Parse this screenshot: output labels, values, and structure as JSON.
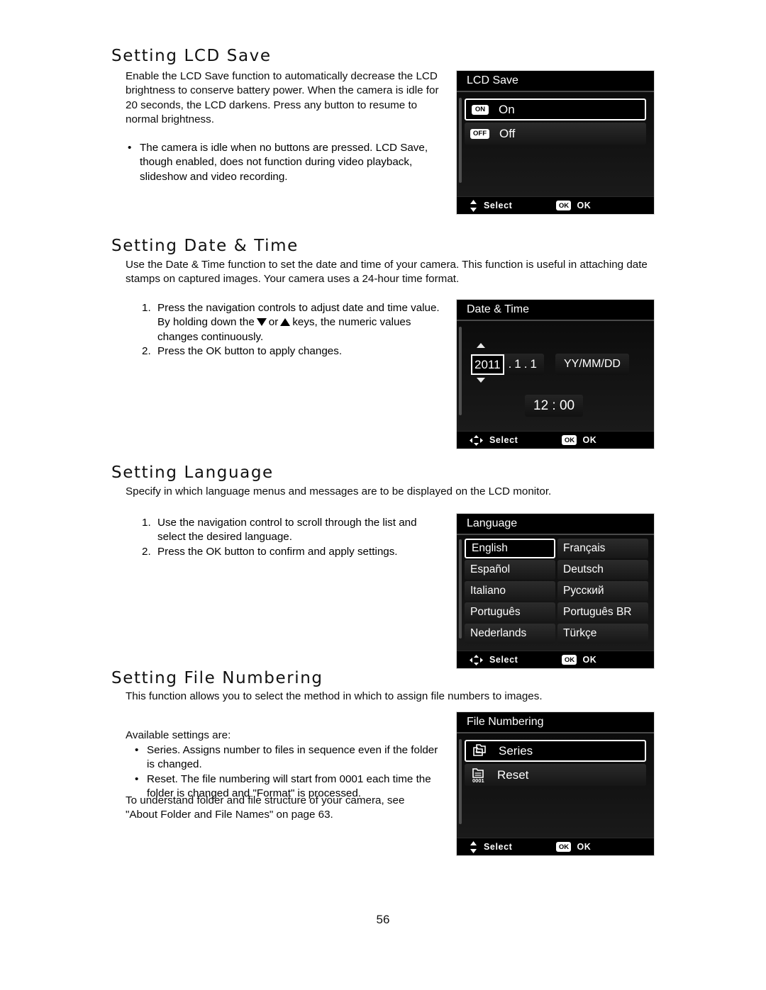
{
  "page": {
    "number": "56"
  },
  "sections": [
    {
      "id": "lcd_save",
      "title": "Setting LCD Save",
      "paragraph": "Enable the LCD Save function to automatically decrease the LCD brightness to conserve battery power. When the camera is idle for 20 seconds, the LCD darkens. Press any button to resume to normal brightness.",
      "bullets": [
        "The camera is idle when no buttons are pressed. LCD Save, though enabled, does not function during video playback, slideshow and video recording."
      ]
    },
    {
      "id": "date_time",
      "title": "Setting Date & Time",
      "paragraph": "Use the Date & Time function to set the date and time of your camera. This function is useful in attaching date stamps on captured images. Your camera uses a 24-hour time format.",
      "steps": [
        {
          "marker": "1.",
          "text_before": "Press the navigation controls to adjust date and time value. By holding down the",
          "text_middle": "or",
          "text_after": "keys, the numeric values changes continuously."
        },
        {
          "marker": "2.",
          "text": "Press the OK button to apply changes."
        }
      ]
    },
    {
      "id": "language",
      "title": "Setting Language",
      "paragraph": "Specify in which language menus and messages are to be displayed on the LCD monitor.",
      "steps": [
        {
          "marker": "1.",
          "text": "Use the navigation control to scroll through the list and select the desired language."
        },
        {
          "marker": "2.",
          "text": "Press the OK button to confirm and apply settings."
        }
      ]
    },
    {
      "id": "file_numbering",
      "title": "Setting File Numbering",
      "paragraph": "This function allows you to select the method in which to assign file numbers to images.",
      "available_label": "Available settings are:",
      "bullets": [
        "Series. Assigns number to files in sequence even if the folder is changed.",
        "Reset. The file numbering will start from 0001 each time the folder is changed and \"Format\" is processed."
      ],
      "closing": "To understand folder and file structure of your camera, see \"About Folder and File Names\" on page 63."
    }
  ],
  "screens": {
    "lcd_save": {
      "title": "LCD Save",
      "options": [
        {
          "badge": "ON",
          "label": "On",
          "selected": true
        },
        {
          "badge": "OFF",
          "label": "Off",
          "selected": false
        }
      ],
      "footer": {
        "nav_icon": "up-down-arrow-icon",
        "nav_label": "Select",
        "ok_badge": "OK",
        "ok_label": "OK"
      }
    },
    "date_time": {
      "title": "Date & Time",
      "year": "2011",
      "separator1": ".",
      "month": "1",
      "separator2": ".",
      "day": "1",
      "format": "YY/MM/DD",
      "time": "12 : 00",
      "footer": {
        "nav_icon": "four-way-arrow-icon",
        "nav_label": "Select",
        "ok_badge": "OK",
        "ok_label": "OK"
      }
    },
    "language": {
      "title": "Language",
      "items": [
        {
          "label": "English",
          "selected": true
        },
        {
          "label": "Français",
          "selected": false
        },
        {
          "label": "Español",
          "selected": false
        },
        {
          "label": "Deutsch",
          "selected": false
        },
        {
          "label": "Italiano",
          "selected": false
        },
        {
          "label": "Русский",
          "selected": false
        },
        {
          "label": "Português",
          "selected": false
        },
        {
          "label": "Português BR",
          "selected": false
        },
        {
          "label": "Nederlands",
          "selected": false
        },
        {
          "label": "Türkçe",
          "selected": false
        }
      ],
      "footer": {
        "nav_icon": "four-way-arrow-icon",
        "nav_label": "Select",
        "ok_badge": "OK",
        "ok_label": "OK"
      }
    },
    "file_numbering": {
      "title": "File Numbering",
      "options": [
        {
          "icon": "folder-series-icon",
          "label": "Series",
          "selected": true,
          "sub": ""
        },
        {
          "icon": "folder-reset-icon",
          "label": "Reset",
          "selected": false,
          "sub": "0001"
        }
      ],
      "footer": {
        "nav_icon": "up-down-arrow-icon",
        "nav_label": "Select",
        "ok_badge": "OK",
        "ok_label": "OK"
      }
    }
  },
  "colors": {
    "panel_bg": "#000000",
    "panel_border": "#d9d9d9",
    "text": "#ffffff",
    "page_bg": "#ffffff"
  }
}
